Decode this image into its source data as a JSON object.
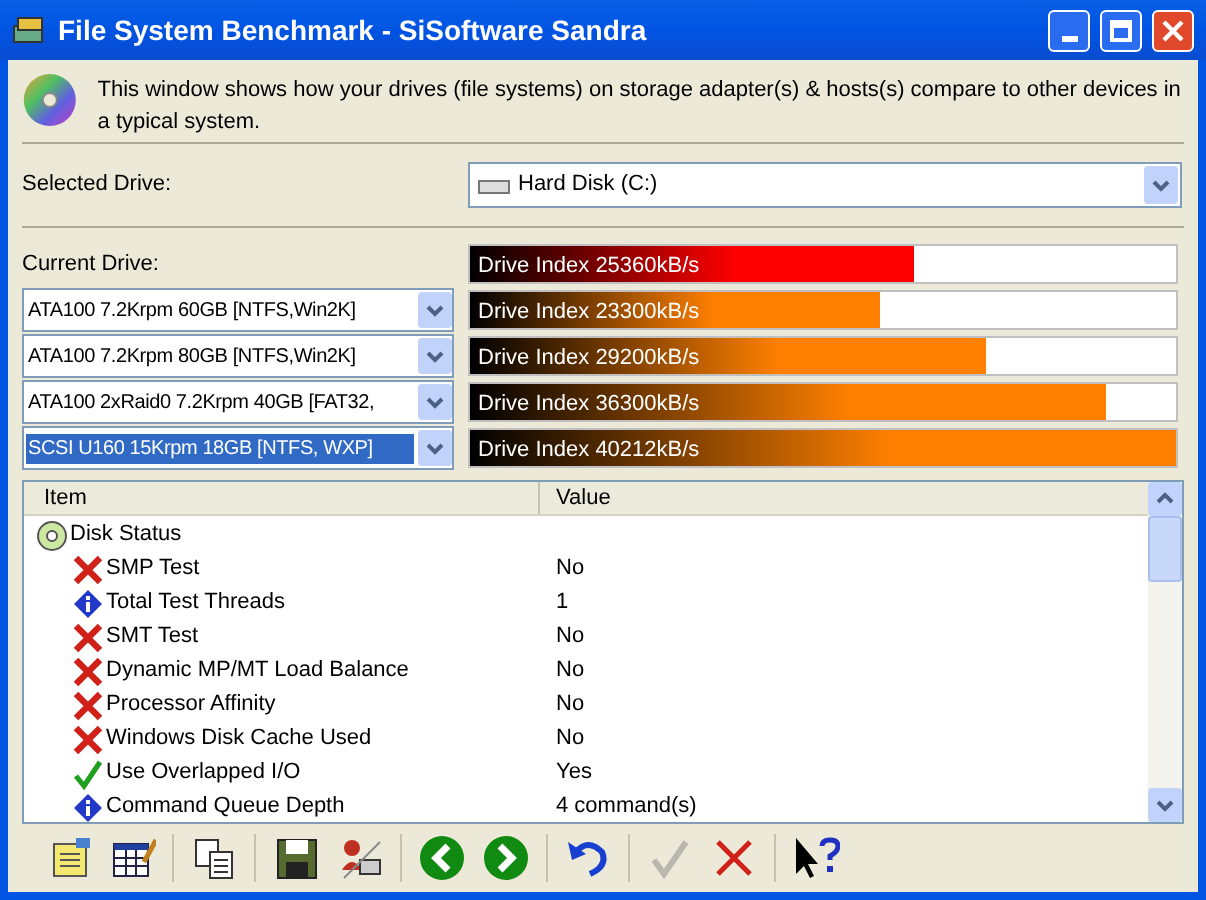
{
  "window": {
    "title": "File System Benchmark - SiSoftware Sandra"
  },
  "description": "This window shows how your drives (file systems) on storage adapter(s) & hosts(s) compare to other devices in a typical system.",
  "selected_drive": {
    "label": "Selected Drive:",
    "value": "Hard Disk (C:)"
  },
  "current_drive_label": "Current Drive:",
  "drives": [
    {
      "reading": "Drive Index 25360kB/s",
      "level": 0.63,
      "color": "#ff0000"
    },
    {
      "name": "ATA100 7.2Krpm 60GB [NTFS,Win2K]",
      "reading": "Drive Index 23300kB/s",
      "level": 0.58,
      "color": "#ff8000",
      "selected": false
    },
    {
      "name": "ATA100 7.2Krpm 80GB [NTFS,Win2K]",
      "reading": "Drive Index 29200kB/s",
      "level": 0.73,
      "color": "#ff8000",
      "selected": false
    },
    {
      "name": "ATA100 2xRaid0 7.2Krpm 40GB [FAT32,",
      "reading": "Drive Index 36300kB/s",
      "level": 0.9,
      "color": "#ff8000",
      "selected": false
    },
    {
      "name": "SCSI U160 15Krpm 18GB [NTFS, WXP]",
      "reading": "Drive Index 40212kB/s",
      "level": 1.0,
      "color": "#ff8000",
      "selected": true
    }
  ],
  "table": {
    "columns": [
      "Item",
      "Value"
    ],
    "rows": [
      {
        "kind": "disk",
        "item": "Disk Status",
        "children": [
          {
            "kind": "cross",
            "item": "SMP Test",
            "value": "No"
          },
          {
            "kind": "info",
            "item": "Total Test Threads",
            "value": "1"
          },
          {
            "kind": "cross",
            "item": "SMT Test",
            "value": "No"
          },
          {
            "kind": "cross",
            "item": "Dynamic MP/MT Load Balance",
            "value": "No"
          },
          {
            "kind": "cross",
            "item": "Processor Affinity",
            "value": "No"
          },
          {
            "kind": "cross",
            "item": "Windows Disk Cache Used",
            "value": "No"
          },
          {
            "kind": "check",
            "item": "Use Overlapped I/O",
            "value": "Yes"
          },
          {
            "kind": "info",
            "item": "Command Queue Depth",
            "value": "4 command(s)"
          }
        ]
      }
    ]
  },
  "toolbar": [
    {
      "kind": "notes",
      "disabled": false
    },
    {
      "kind": "report",
      "disabled": false
    },
    {
      "kind": "sep"
    },
    {
      "kind": "copy",
      "disabled": false
    },
    {
      "kind": "sep"
    },
    {
      "kind": "save",
      "disabled": false
    },
    {
      "kind": "user",
      "disabled": false
    },
    {
      "kind": "sep"
    },
    {
      "kind": "back",
      "disabled": false
    },
    {
      "kind": "forward",
      "disabled": false
    },
    {
      "kind": "sep"
    },
    {
      "kind": "refresh",
      "disabled": false
    },
    {
      "kind": "sep"
    },
    {
      "kind": "ok",
      "disabled": true
    },
    {
      "kind": "cancel",
      "disabled": false
    },
    {
      "kind": "sep"
    },
    {
      "kind": "help",
      "disabled": false
    }
  ]
}
